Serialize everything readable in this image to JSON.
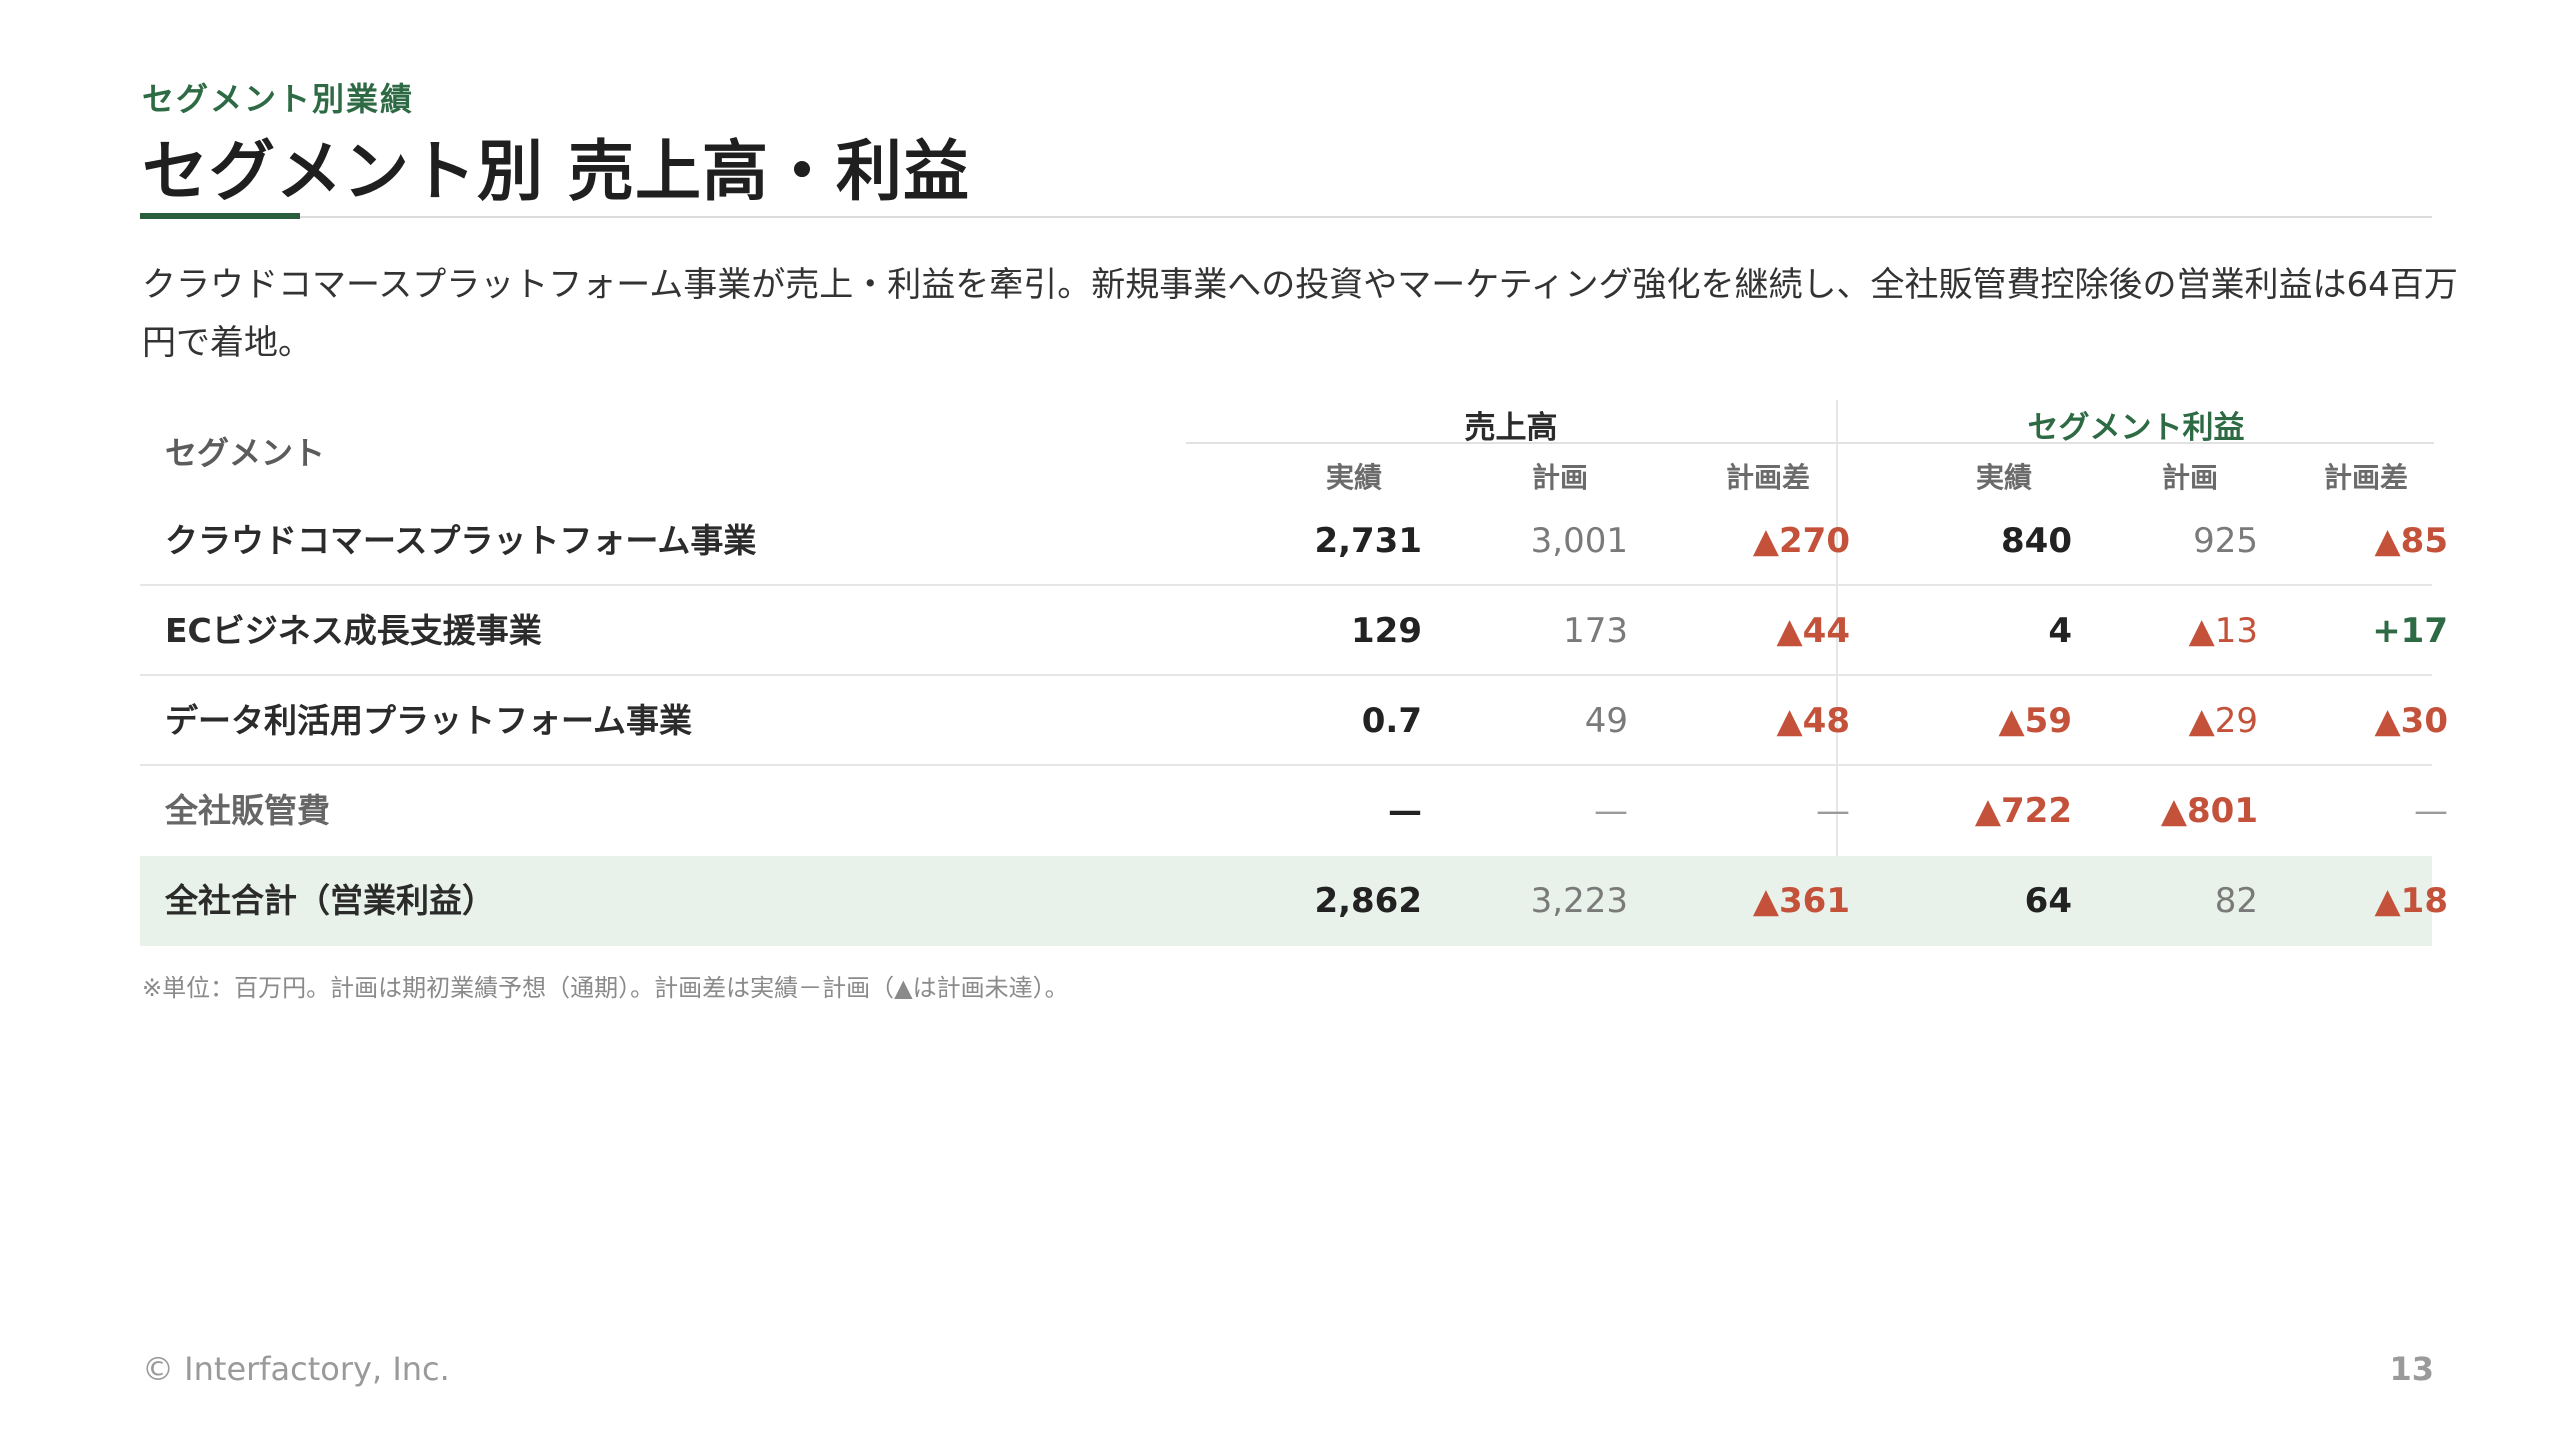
{
  "header": {
    "eyebrow": "セグメント別業績",
    "title": "セグメント別 売上高・利益"
  },
  "lead": "クラウドコマースプラットフォーム事業が売上・利益を牽引。新規事業への投資やマーケティング強化を継続し、全社販管費控除後の営業利益は64百万円で着地。",
  "table": {
    "segment_header": "セグメント",
    "group_sales": "売上高",
    "group_profit": "セグメント利益",
    "sub_headers": [
      "実績",
      "計画",
      "計画差",
      "実績",
      "計画",
      "計画差"
    ],
    "rows": [
      {
        "label": "クラウドコマースプラットフォーム事業",
        "values": [
          "2,731",
          "3,001",
          "▲270",
          "840",
          "925",
          "▲85"
        ]
      },
      {
        "label": "ECビジネス成長支援事業",
        "values": [
          "129",
          "173",
          "▲44",
          "4",
          "▲13",
          "+17"
        ]
      },
      {
        "label": "データ利活用プラットフォーム事業",
        "values": [
          "0.7",
          "49",
          "▲48",
          "▲59",
          "▲29",
          "▲30"
        ]
      },
      {
        "label": "全社販管費",
        "values": [
          "—",
          "—",
          "—",
          "▲722",
          "▲801",
          "—"
        ]
      },
      {
        "label": "全社合計（営業利益）",
        "values": [
          "2,862",
          "3,223",
          "▲361",
          "64",
          "82",
          "▲18"
        ]
      }
    ]
  },
  "colors": {
    "accent_green": "#2e6b45",
    "negative_red": "#c4513a",
    "total_row_bg": "#e8f2ea"
  },
  "note": "※単位：百万円。計画は期初業績予想（通期）。計画差は実績－計画（▲は計画未達）。",
  "footer": {
    "copyright": "© Interfactory, Inc.",
    "page_number": "13"
  }
}
